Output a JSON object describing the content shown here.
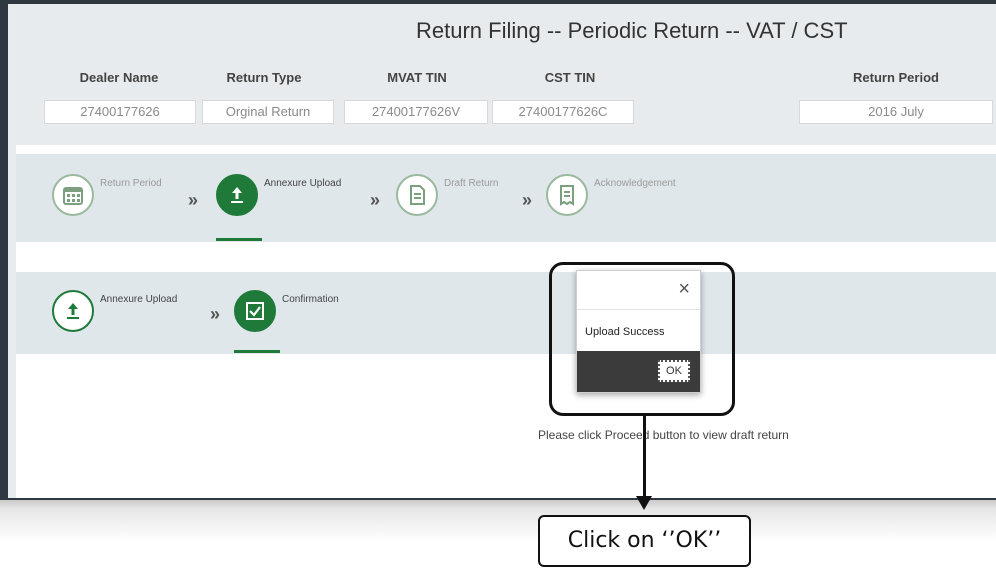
{
  "page": {
    "title": "Return Filing -- Periodic Return -- VAT / CST"
  },
  "dealer_info": {
    "headers": [
      "Dealer Name",
      "Return Type",
      "MVAT TIN",
      "CST TIN",
      "Return Period"
    ],
    "values": [
      "27400177626",
      "Orginal Return",
      "27400177626V",
      "27400177626C",
      "2016 July"
    ]
  },
  "main_steps": {
    "items": [
      {
        "label": "Return Period",
        "icon": "calendar-icon",
        "active": false
      },
      {
        "label": "Annexure Upload",
        "icon": "upload-icon",
        "active": true
      },
      {
        "label": "Draft Return",
        "icon": "document-icon",
        "active": false
      },
      {
        "label": "Acknowledgement",
        "icon": "receipt-icon",
        "active": false
      }
    ],
    "separator": "»"
  },
  "sub_steps": {
    "items": [
      {
        "label": "Annexure Upload",
        "icon": "upload-icon",
        "active": false
      },
      {
        "label": "Confirmation",
        "icon": "checkbox-icon",
        "active": true
      }
    ],
    "separator": "»"
  },
  "instruction": "Please click Proceed button to view draft return",
  "modal": {
    "close_glyph": "×",
    "message": "Upload Success",
    "ok_label": "OK"
  },
  "annotation": {
    "label": "Click on ‘’OK’’"
  },
  "colors": {
    "accent": "#1f7a3a",
    "band": "#dfe7eb",
    "header": "#e8ebed",
    "modal_footer": "#3b3b3b"
  }
}
